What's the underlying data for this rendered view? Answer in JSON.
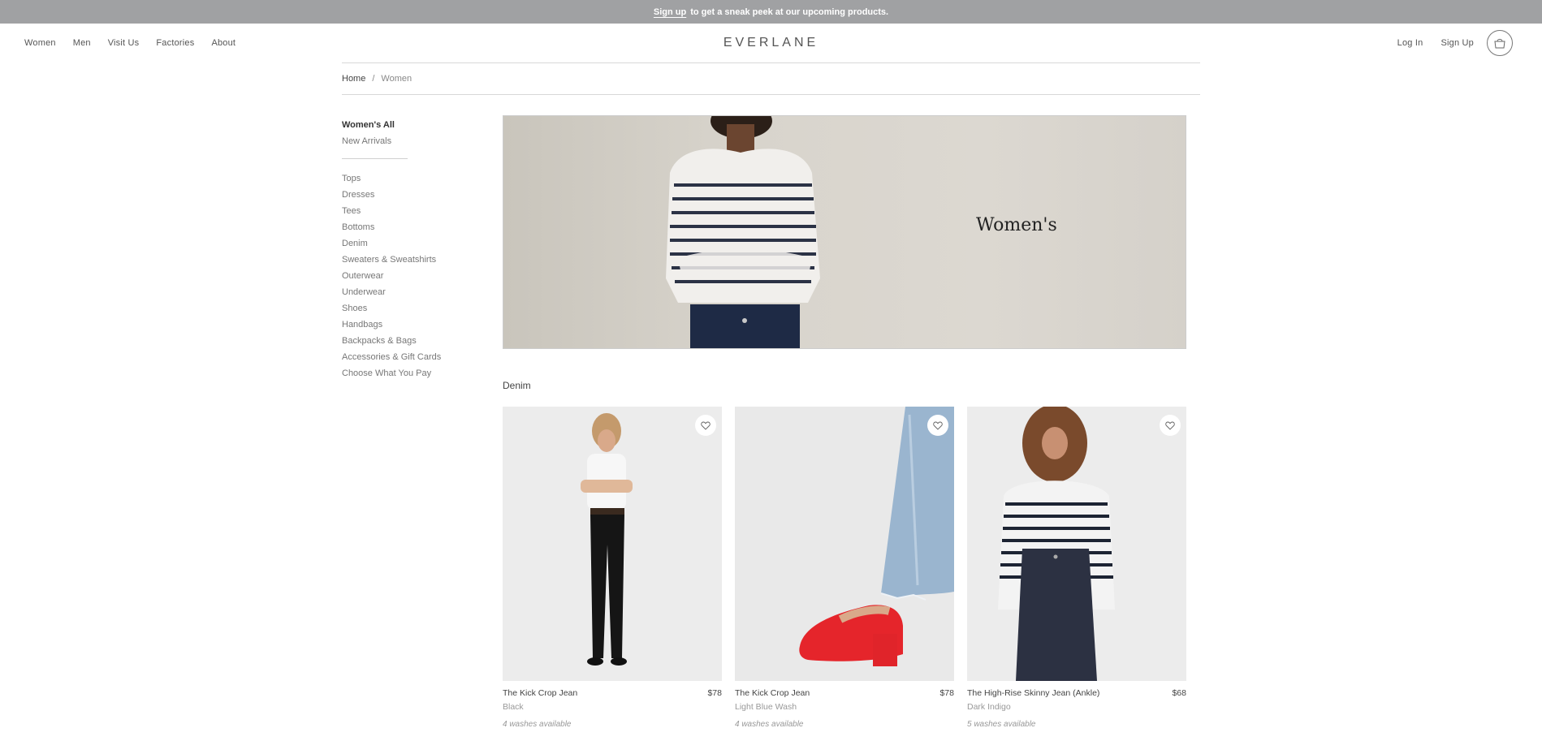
{
  "promo": {
    "link_label": "Sign up",
    "message": "to get a sneak peek at our upcoming products."
  },
  "nav": {
    "left": [
      "Women",
      "Men",
      "Visit Us",
      "Factories",
      "About"
    ],
    "logo": "EVERLANE",
    "right": [
      "Log In",
      "Sign Up"
    ],
    "cart_icon": "bag-icon"
  },
  "breadcrumb": {
    "home": "Home",
    "separator": "/",
    "current": "Women"
  },
  "sidebar": {
    "top": [
      "Women's All",
      "New Arrivals"
    ],
    "categories": [
      "Tops",
      "Dresses",
      "Tees",
      "Bottoms",
      "Denim",
      "Sweaters & Sweatshirts",
      "Outerwear",
      "Underwear",
      "Shoes",
      "Handbags",
      "Backpacks & Bags",
      "Accessories & Gift Cards",
      "Choose What You Pay"
    ]
  },
  "hero": {
    "title": "Women's"
  },
  "section": {
    "title": "Denim"
  },
  "products": [
    {
      "name": "The Kick Crop Jean",
      "price": "$78",
      "color": "Black",
      "washes": "4 washes available"
    },
    {
      "name": "The Kick Crop Jean",
      "price": "$78",
      "color": "Light Blue Wash",
      "washes": "4 washes available"
    },
    {
      "name": "The High-Rise Skinny Jean (Ankle)",
      "price": "$68",
      "color": "Dark Indigo",
      "washes": "5 washes available"
    }
  ],
  "colors": {
    "promo_bg": "#a0a1a3",
    "hero_bg": "#d8d4cc",
    "shoe_red": "#e5252b"
  }
}
